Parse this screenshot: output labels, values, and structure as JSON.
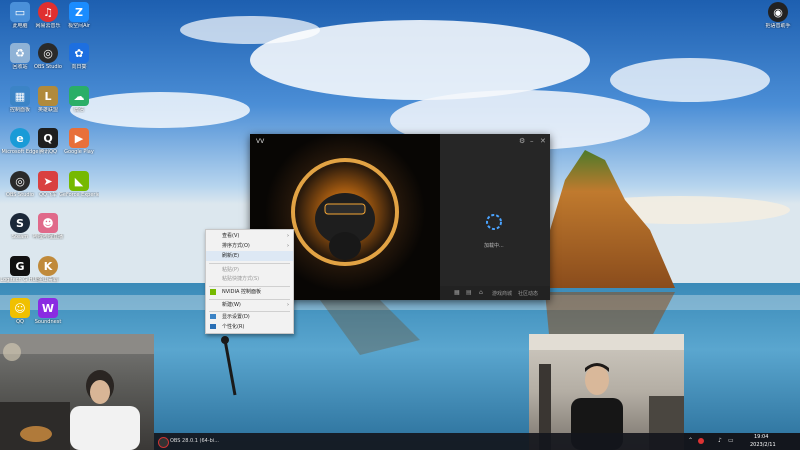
{
  "desktop_icons": [
    {
      "label": "此电脑",
      "icon": "computer-icon",
      "color": "#4a90d9"
    },
    {
      "label": "网易云音乐",
      "icon": "netease-music-icon",
      "color": "#e03030"
    },
    {
      "label": "极空间Air",
      "icon": "zspace-icon",
      "color": "#1a8cff"
    },
    {
      "label": "回收站",
      "icon": "recycle-bin-icon",
      "color": "#8fb2d6"
    },
    {
      "label": "OBS Studio",
      "icon": "obs-icon",
      "color": "#2a2a2a"
    },
    {
      "label": "向日葵",
      "icon": "sunflower-icon",
      "color": "#1d6fe0"
    },
    {
      "label": "控制面板",
      "icon": "control-panel-icon",
      "color": "#3c84c6"
    },
    {
      "label": "英雄联盟",
      "icon": "lol-icon",
      "color": "#b08a3c"
    },
    {
      "label": "微信",
      "icon": "wechat-icon",
      "color": "#2aae67"
    },
    {
      "label": "Microsoft Edge",
      "icon": "edge-icon",
      "color": "#1a9bd7"
    },
    {
      "label": "腾讯QQ",
      "icon": "qq-icon",
      "color": "#1e1e1e"
    },
    {
      "label": "Google Play",
      "icon": "google-play-icon",
      "color": "#e8703a"
    },
    {
      "label": "OBS Studio",
      "icon": "obs2-icon",
      "color": "#2a2a2a"
    },
    {
      "label": "QQ飞车",
      "icon": "qq-speed-icon",
      "color": "#d94040"
    },
    {
      "label": "GeForce Experience",
      "icon": "nvidia-icon",
      "color": "#76b900"
    },
    {
      "label": "Steam",
      "icon": "steam-icon",
      "color": "#1b2838"
    },
    {
      "label": "哔哩哔哩直播",
      "icon": "bilibili-live-icon",
      "color": "#e06a8a"
    },
    {
      "label": "Logitech G HUB",
      "icon": "ghub-icon",
      "color": "#111111"
    },
    {
      "label": "金山毒霸",
      "icon": "kingsoft-icon",
      "color": "#c08a3a"
    },
    {
      "label": "QQ",
      "icon": "qq2-icon",
      "color": "#f0c000"
    },
    {
      "label": "Soundnest",
      "icon": "soundnest-icon",
      "color": "#8a2be2"
    }
  ],
  "top_right_icon": {
    "label": "把语音助手",
    "icon": "assistant-icon"
  },
  "vv_window": {
    "title": "VV",
    "loading_text": "加载中...",
    "bottom_bar": [
      "游戏商城",
      "社区动态"
    ],
    "controls": [
      "settings-icon",
      "minimize-icon",
      "close-icon"
    ]
  },
  "context_menu": {
    "items": [
      {
        "label": "查看(V)",
        "submenu": true,
        "type": "item"
      },
      {
        "label": "排序方式(O)",
        "submenu": true,
        "type": "item"
      },
      {
        "label": "刷新(E)",
        "submenu": false,
        "type": "item",
        "highlight": true
      },
      {
        "type": "separator"
      },
      {
        "label": "粘贴(P)",
        "submenu": false,
        "type": "item",
        "disabled": true
      },
      {
        "label": "粘贴快捷方式(S)",
        "submenu": false,
        "type": "item",
        "disabled": true
      },
      {
        "type": "separator"
      },
      {
        "label": "NVIDIA 控制面板",
        "submenu": false,
        "type": "item",
        "icon": "nvidia-icon"
      },
      {
        "type": "separator"
      },
      {
        "label": "新建(W)",
        "submenu": true,
        "type": "item"
      },
      {
        "type": "separator"
      },
      {
        "label": "显示设置(D)",
        "submenu": false,
        "type": "item",
        "icon": "display-icon"
      },
      {
        "label": "个性化(R)",
        "submenu": false,
        "type": "item",
        "icon": "personalize-icon"
      }
    ]
  },
  "taskbar": {
    "app_label": "OBS 28.0.1 (64-bi...",
    "time": "19:04",
    "date": "2023/2/11"
  }
}
